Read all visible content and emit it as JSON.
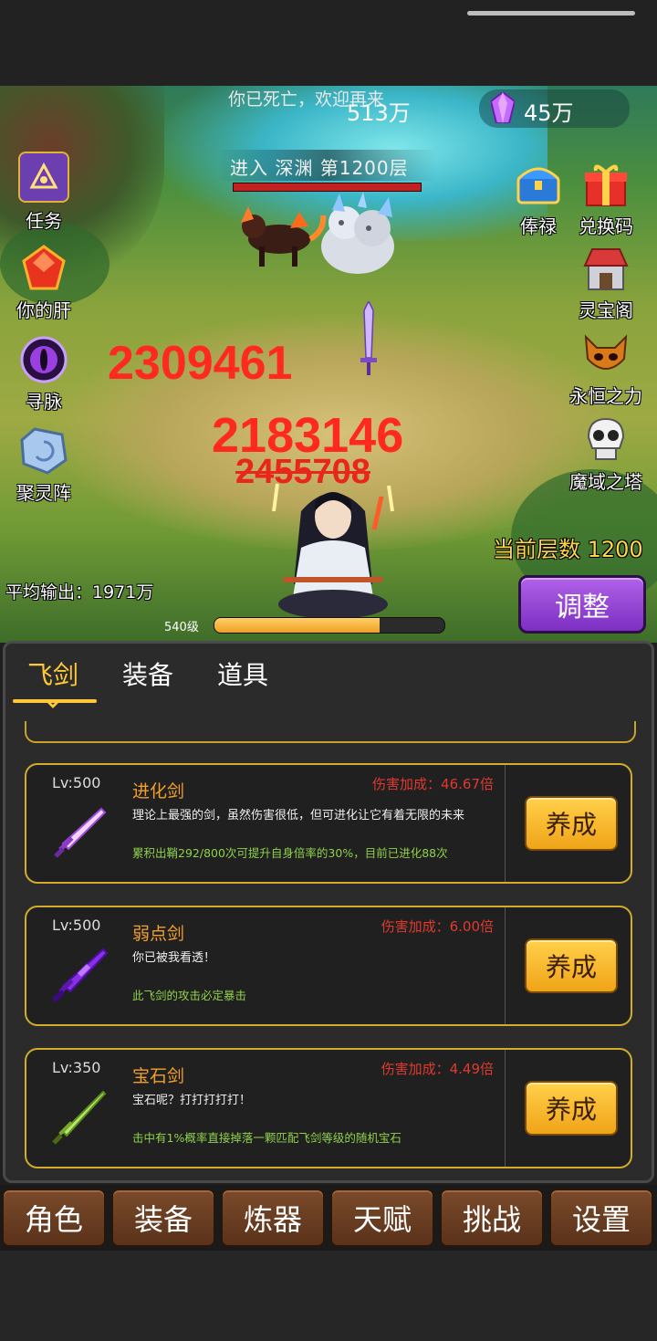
{
  "status": {
    "ghost_notice": "你已死亡，欢迎再来",
    "money": "513万",
    "gems": "45万"
  },
  "stage": {
    "text": "进入 深渊 第1200层"
  },
  "left_buttons": [
    {
      "label": "任务",
      "icon": "quest-book-icon"
    },
    {
      "label": "你的肝",
      "icon": "red-crystal-icon"
    },
    {
      "label": "寻脉",
      "icon": "purple-eye-icon"
    },
    {
      "label": "聚灵阵",
      "icon": "spirit-stone-icon"
    }
  ],
  "right_buttons": [
    {
      "label": "俸禄",
      "icon": "treasure-chest-icon"
    },
    {
      "label": "兑换码",
      "icon": "gift-box-icon"
    },
    {
      "label": "灵宝阁",
      "icon": "shop-icon"
    },
    {
      "label": "永恒之力",
      "icon": "demon-mask-icon"
    },
    {
      "label": "魔域之塔",
      "icon": "skull-icon"
    }
  ],
  "damage_numbers": [
    "2309461",
    "2183146",
    "2455708"
  ],
  "floor": {
    "text": "当前层数 1200"
  },
  "adjust_label": "调整",
  "avg_output": "平均输出：1971万",
  "player": {
    "level": "540级",
    "xp_fraction": 0.72
  },
  "tabs": [
    "飞剑",
    "装备",
    "道具"
  ],
  "swords": [
    {
      "lv": "Lv:500",
      "name": "进化剑",
      "damage": "伤害加成：46.67倍",
      "desc": "理论上最强的剑，虽然伤害很低，但可进化让它有着无限的未来",
      "effect": "累积出鞘292/800次可提升自身倍率的30%，目前已进化88次",
      "button": "养成",
      "color": "#e8a6ff"
    },
    {
      "lv": "Lv:500",
      "name": "弱点剑",
      "damage": "伤害加成：6.00倍",
      "desc": "你已被我看透！",
      "effect": "此飞剑的攻击必定暴击",
      "button": "养成",
      "color": "#9b3ff0"
    },
    {
      "lv": "Lv:350",
      "name": "宝石剑",
      "damage": "伤害加成：4.49倍",
      "desc": "宝石呢？打打打打打！",
      "effect": "击中有1%概率直接掉落一颗匹配飞剑等级的随机宝石",
      "button": "养成",
      "color": "#9bd23a"
    }
  ],
  "bottom_nav": [
    "角色",
    "装备",
    "炼器",
    "天赋",
    "挑战",
    "设置"
  ]
}
